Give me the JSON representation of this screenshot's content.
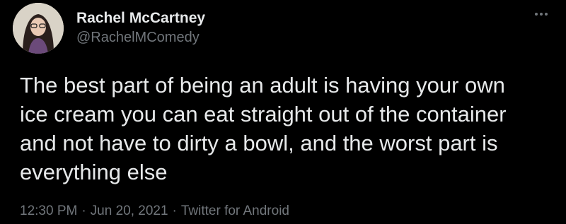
{
  "author": {
    "display_name": "Rachel McCartney",
    "handle": "@RachelMComedy"
  },
  "tweet": {
    "text": "The best part of being an adult is having your own\nice cream you can eat straight out of the container\nand not have to dirty a bowl, and the worst part is\neverything else",
    "time": "12:30 PM",
    "date": "Jun 20, 2021",
    "source": "Twitter for Android",
    "separator": "·"
  },
  "icons": {
    "more": "more-options-icon"
  },
  "colors": {
    "background": "#000000",
    "primary_text": "#e7e9ea",
    "secondary_text": "#71767b"
  }
}
